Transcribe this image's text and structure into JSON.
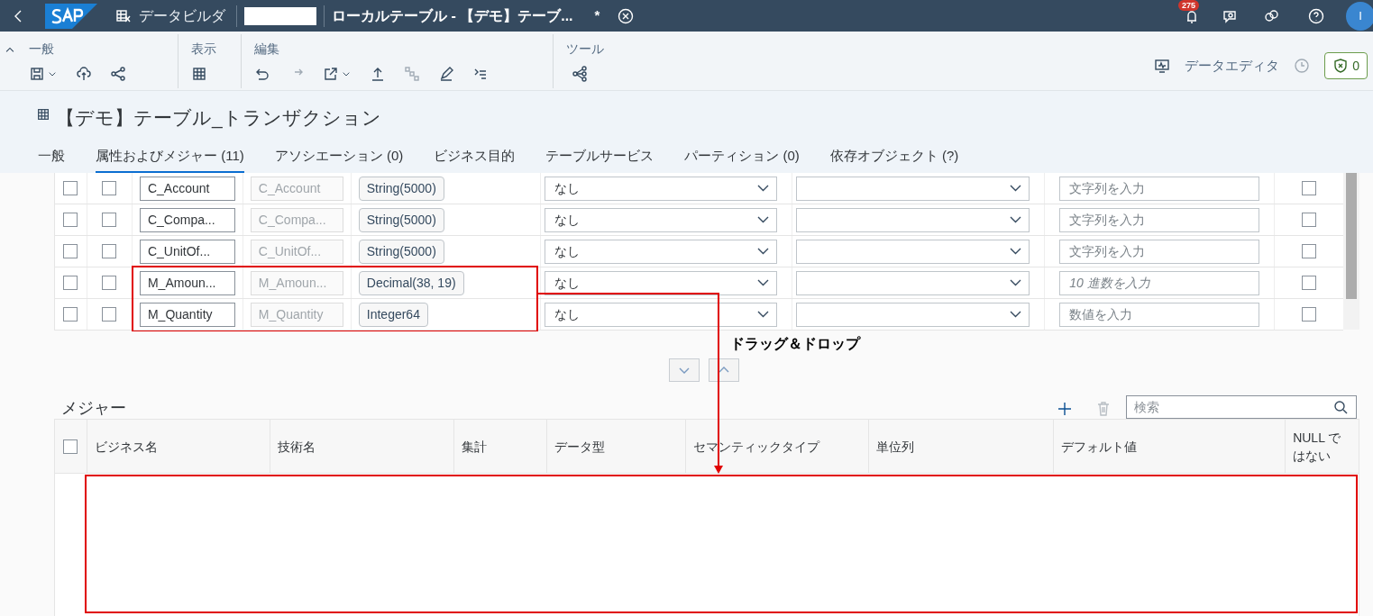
{
  "shell_bar": {
    "app_title": "データビルダ",
    "tab_title": "ローカルテーブル - 【デモ】テーブ...",
    "unsaved_mark": "*",
    "notification_count": "275",
    "avatar_initial": "I"
  },
  "toolbar": {
    "groups": [
      {
        "label": "一般"
      },
      {
        "label": "表示"
      },
      {
        "label": "編集"
      },
      {
        "label": "ツール"
      }
    ],
    "data_editor": "データエディタ",
    "validation_count": "0"
  },
  "object_header": {
    "title": "【デモ】テーブル_トランザクション"
  },
  "tabs": [
    {
      "label": "一般",
      "selected": false
    },
    {
      "label": "属性およびメジャー (11)",
      "selected": true
    },
    {
      "label": "アソシエーション (0)",
      "selected": false
    },
    {
      "label": "ビジネス目的",
      "selected": false
    },
    {
      "label": "テーブルサービス",
      "selected": false
    },
    {
      "label": "パーティション (0)",
      "selected": false
    },
    {
      "label": "依存オブジェクト (?)",
      "selected": false
    }
  ],
  "attributes_table": {
    "rows": [
      {
        "business_name": "C_Account",
        "technical_name": "C_Account",
        "data_type": "String(5000)",
        "semantic_type": "なし",
        "default_placeholder": "文字列を入力",
        "placeholder_italic": false,
        "highlighted": false,
        "selected": false,
        "key": false,
        "not_null": false
      },
      {
        "business_name": "C_Compa...",
        "technical_name": "C_Compa...",
        "data_type": "String(5000)",
        "semantic_type": "なし",
        "default_placeholder": "文字列を入力",
        "placeholder_italic": false,
        "highlighted": false,
        "selected": false,
        "key": false,
        "not_null": false
      },
      {
        "business_name": "C_UnitOf...",
        "technical_name": "C_UnitOf...",
        "data_type": "String(5000)",
        "semantic_type": "なし",
        "default_placeholder": "文字列を入力",
        "placeholder_italic": false,
        "highlighted": false,
        "selected": false,
        "key": false,
        "not_null": false
      },
      {
        "business_name": "M_Amoun...",
        "technical_name": "M_Amoun...",
        "data_type": "Decimal(38, 19)",
        "semantic_type": "なし",
        "default_placeholder": "10 進数を入力",
        "placeholder_italic": true,
        "highlighted": true,
        "selected": false,
        "key": false,
        "not_null": false
      },
      {
        "business_name": "M_Quantity",
        "technical_name": "M_Quantity",
        "data_type": "Integer64",
        "semantic_type": "なし",
        "default_placeholder": "数値を入力",
        "placeholder_italic": false,
        "highlighted": true,
        "selected": false,
        "key": false,
        "not_null": false
      }
    ]
  },
  "annotation": {
    "label": "ドラッグ＆ドロップ"
  },
  "measures": {
    "title": "メジャー",
    "select_all": false,
    "search": {
      "placeholder": "検索"
    },
    "columns": [
      "ビジネス名",
      "技術名",
      "集計",
      "データ型",
      "セマンティックタイプ",
      "単位列",
      "デフォルト値",
      "NULL ではない"
    ]
  }
}
